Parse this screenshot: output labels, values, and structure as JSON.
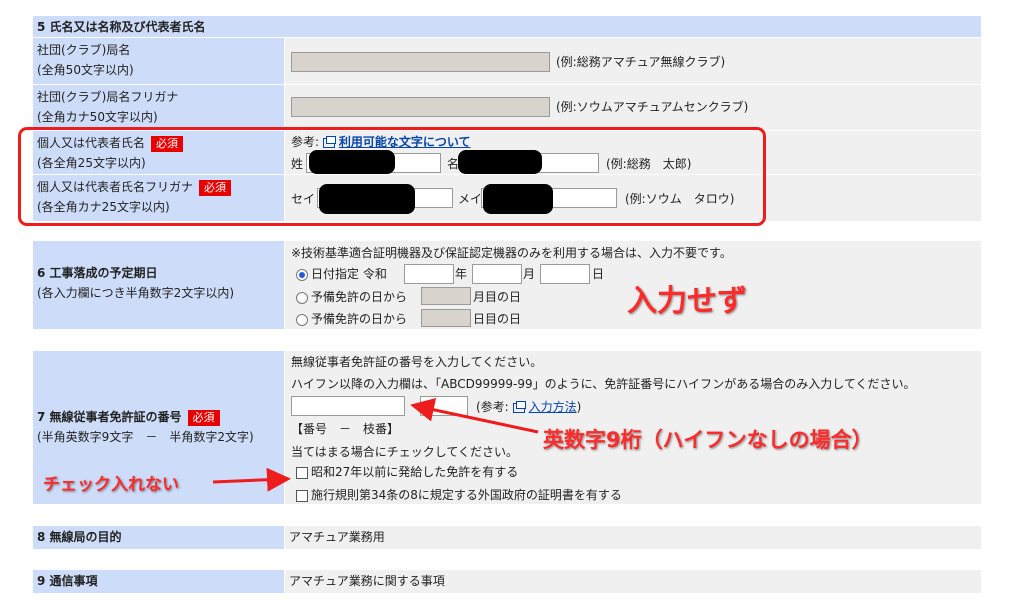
{
  "sec5": {
    "header": "5 氏名又は名称及び代表者氏名",
    "club_label": "社団(クラブ)局名",
    "club_note": "(全角50文字以内)",
    "club_example": "(例:総務アマチュア無線クラブ)",
    "club_kana_label": "社団(クラブ)局名フリガナ",
    "club_kana_note": "(全角カナ50文字以内)",
    "club_kana_example": "(例:ソウムアマチュアムセンクラブ)",
    "rep_label": "個人又は代表者氏名",
    "rep_note": "(各全角25文字以内)",
    "required": "必須",
    "ref_prefix": "参考:",
    "ref_link": "利用可能な文字について",
    "surname_label": "姓",
    "given_label": "名",
    "rep_example": "(例:総務　太郎)",
    "rep_kana_label": "個人又は代表者氏名フリガナ",
    "rep_kana_note": "(各全角カナ25文字以内)",
    "sei_label": "セイ",
    "mei_label": "メイ",
    "rep_kana_example": "(例:ソウム　タロウ)"
  },
  "sec6": {
    "header": "6 工事落成の予定期日",
    "note": "(各入力欄につき半角数字2文字以内)",
    "info": "※技術基準適合証明機器及び保証認定機器のみを利用する場合は、入力不要です。",
    "opt1": "日付指定 令和",
    "year": "年",
    "month": "月",
    "day": "日",
    "opt2_a": "予備免許の日から",
    "opt2_b": "月目の日",
    "opt3_a": "予備免許の日から",
    "opt3_b": "日目の日"
  },
  "sec7": {
    "header": "7 無線従事者免許証の番号",
    "note": "(半角英数字9文字　－　半角数字2文字)",
    "required": "必須",
    "info1": "無線従事者免許証の番号を入力してください。",
    "info2": "ハイフン以降の入力欄は、「ABCD99999-99」のように、免許証番号にハイフンがある場合のみ入力してください。",
    "ref_prefix": "(参考:",
    "ref_link": "入力方法",
    "ref_suffix": ")",
    "fmt": "【番号　－　枝番】",
    "check_info": "当てはまる場合にチェックしてください。",
    "check1": "昭和27年以前に発給した免許を有する",
    "check2": "施行規則第34条の8に規定する外国政府の証明書を有する"
  },
  "sec8": {
    "header": "8 無線局の目的",
    "value": "アマチュア業務用"
  },
  "sec9": {
    "header": "9 通信事項",
    "value": "アマチュア業務に関する事項"
  },
  "annotations": {
    "no_input": "入力せず",
    "alnum9": "英数字9桁（ハイフンなしの場合）",
    "no_check": "チェック入れない"
  },
  "colors": {
    "label_bg": "#cddcf8",
    "value_bg": "#f0f0f0",
    "annotation": "#ff2a2a",
    "link": "#0645ad"
  }
}
